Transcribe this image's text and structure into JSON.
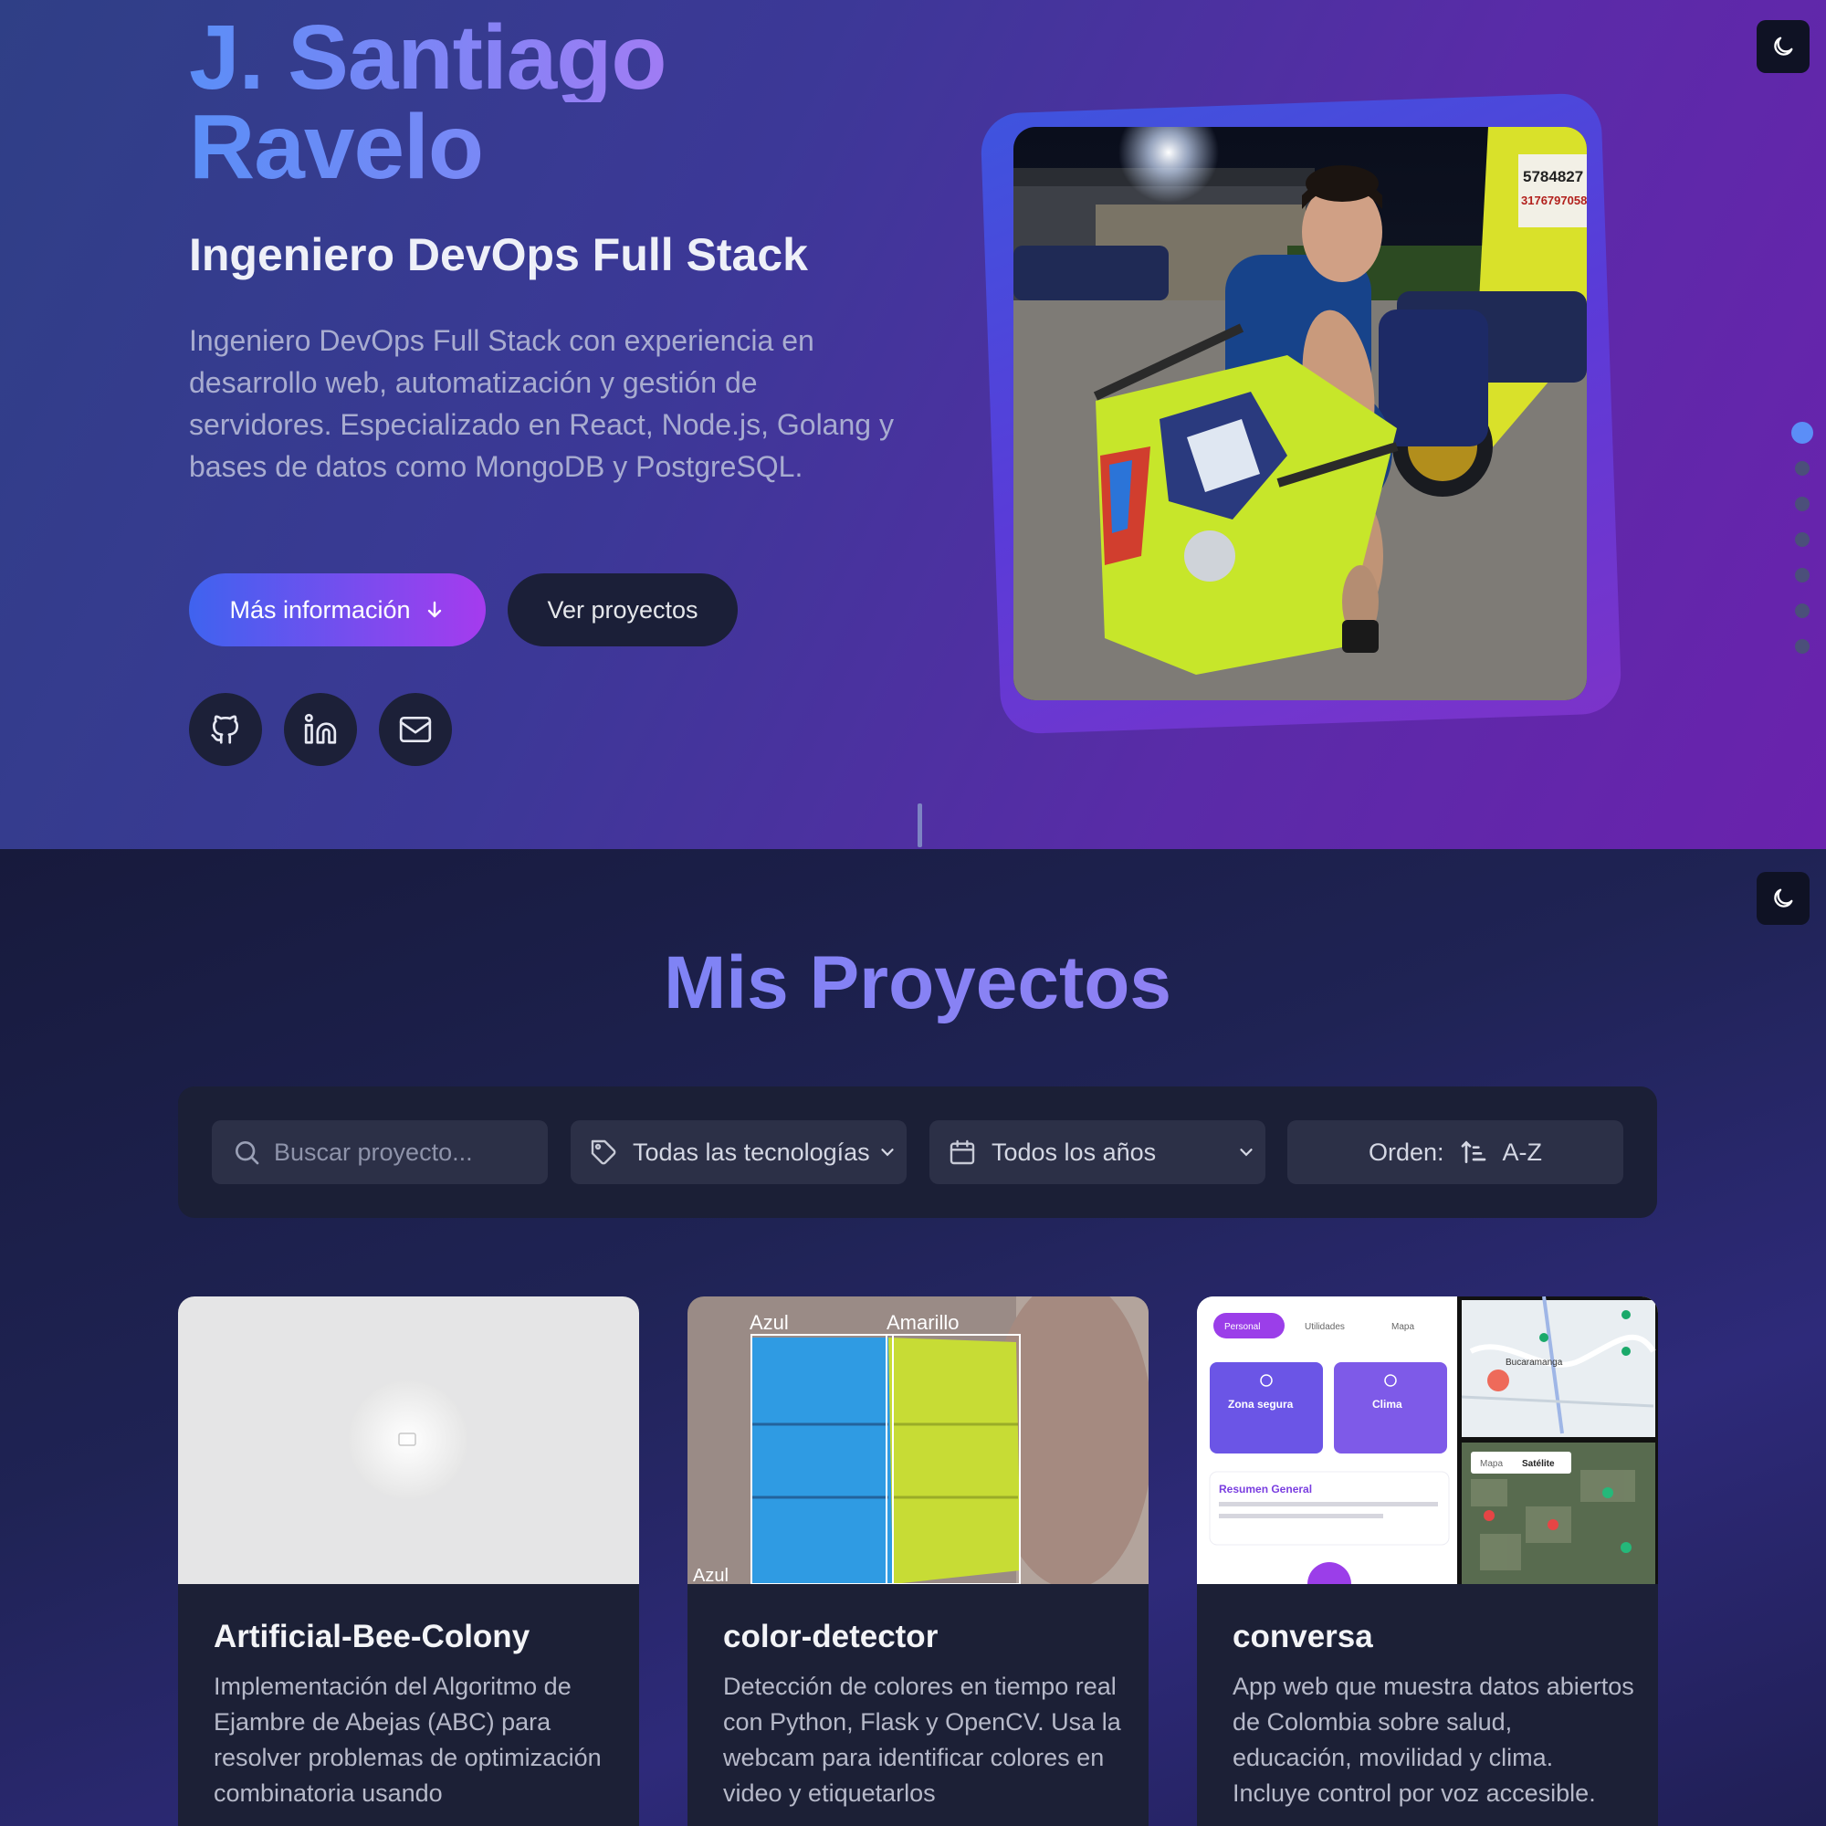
{
  "hero": {
    "name_line1": "J. Santiago",
    "name_line2": "Ravelo",
    "role": "Ingeniero DevOps Full Stack",
    "description": "Ingeniero DevOps Full Stack con experiencia en desarrollo web, automatización y gestión de servidores. Especializado en React, Node.js, Golang y bases de datos como MongoDB y PostgreSQL.",
    "primary_button": "Más información",
    "secondary_button": "Ver proyectos",
    "social_icons": [
      "github-icon",
      "linkedin-icon",
      "mail-icon"
    ],
    "photo_sign": {
      "line1": "5784827",
      "line2": "3176797058"
    },
    "section_dots": {
      "total": 7,
      "active": 1
    }
  },
  "theme_toggle_icon": "moon-icon",
  "projects": {
    "title": "Mis Proyectos",
    "filters": {
      "search_placeholder": "Buscar proyecto...",
      "tech_select": "Todas las tecnologías",
      "year_select": "Todos los años",
      "order_label": "Orden:",
      "order_value": "A-Z"
    },
    "cards": [
      {
        "title": "Artificial-Bee-Colony",
        "description": "Implementación del Algoritmo de Ejambre de Abejas (ABC) para resolver problemas de optimización combinatoria usando"
      },
      {
        "title": "color-detector",
        "description": "Detección de colores en tiempo real con Python, Flask y OpenCV. Usa la webcam para identificar colores en video y etiquetarlos",
        "thumb_labels": [
          "Azul",
          "Amarillo",
          "Azul"
        ]
      },
      {
        "title": "conversa",
        "description": "App web que muestra datos abiertos de Colombia sobre salud, educación, movilidad y clima. Incluye control por voz accesible.",
        "thumb": {
          "tabs": [
            "Personal",
            "Utilidades",
            "Mapa"
          ],
          "tile1": "Zona segura",
          "tile2": "Clima",
          "summary": "Resumen General",
          "map_city": "Bucaramanga",
          "map_toggle": [
            "Mapa",
            "Satélite"
          ]
        }
      }
    ]
  },
  "colors": {
    "accent_blue": "#5b8ef7",
    "accent_purple": "#a53bee",
    "dark_surface": "#1c2036"
  }
}
